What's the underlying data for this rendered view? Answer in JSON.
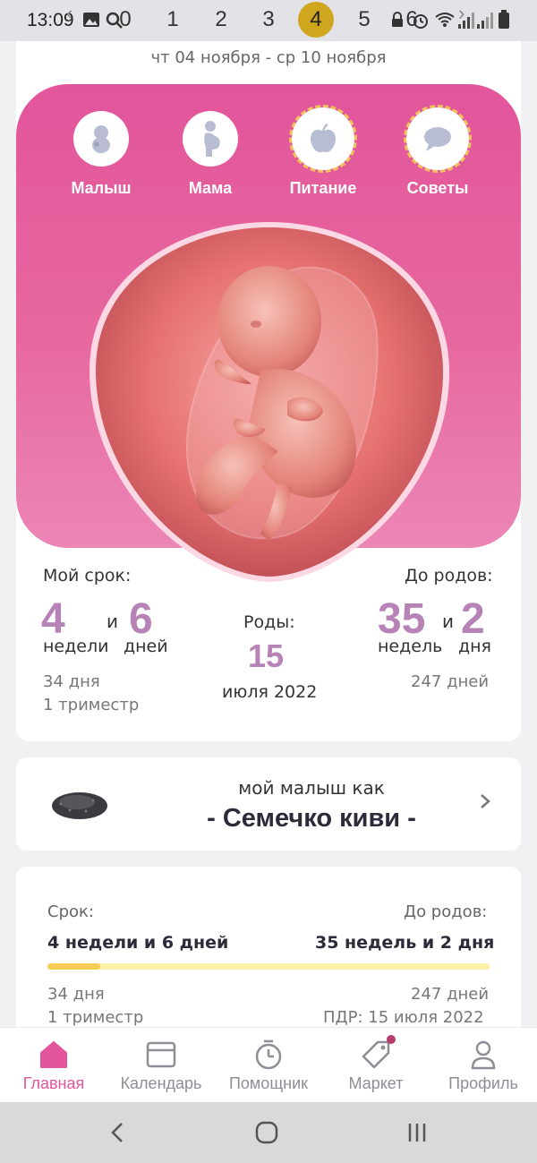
{
  "status_bar": {
    "time": "13:09",
    "week_numbers": [
      "0",
      "1",
      "2",
      "3",
      "4",
      "5",
      "6"
    ],
    "active_week": "4",
    "icons": [
      "gallery-icon",
      "search-icon",
      "lock-icon",
      "alarm-icon",
      "wifi-icon",
      "signal-icon",
      "battery-icon"
    ]
  },
  "header": {
    "date_range": "чт 04 ноября - ср 10 ноября"
  },
  "category_nav": [
    {
      "label": "Малыш",
      "icon": "baby-icon"
    },
    {
      "label": "Мама",
      "icon": "pregnant-woman-icon"
    },
    {
      "label": "Питание",
      "icon": "apple-icon"
    },
    {
      "label": "Советы",
      "icon": "chat-bubble-icon"
    }
  ],
  "stats": {
    "my_term_label": "Мой срок:",
    "weeks_value": "4",
    "weeks_unit": "недели",
    "and_text": "и",
    "days_value": "6",
    "days_unit": "дней",
    "total_days": "34 дня",
    "trimester": "1 триместр",
    "birth_label": "Роды:",
    "birth_day": "15",
    "birth_month_year": "июля 2022",
    "until_birth_label": "До родов:",
    "remaining_weeks": "35",
    "remaining_weeks_unit": "недель",
    "remaining_and": "и",
    "remaining_days": "2",
    "remaining_days_unit": "дня",
    "remaining_total_days": "247 дней"
  },
  "size_card": {
    "subtitle": "мой малыш как",
    "title": "- Семечко киви -",
    "image": "kiwi-seeds-image"
  },
  "progress_card": {
    "term_label": "Срок:",
    "term_value": "4 недели и 6 дней",
    "until_label": "До родов:",
    "until_value": "35 недель и 2 дня",
    "progress_fraction": 0.12,
    "days": "34 дня",
    "trimester": "1 триместр",
    "remaining_days": "247 дней",
    "due_date": "ПДР: 15 июля 2022"
  },
  "bottom_nav": [
    {
      "label": "Главная",
      "icon": "home-icon",
      "active": true
    },
    {
      "label": "Календарь",
      "icon": "calendar-icon",
      "active": false
    },
    {
      "label": "Помощник",
      "icon": "timer-icon",
      "active": false
    },
    {
      "label": "Маркет",
      "icon": "tag-icon",
      "active": false,
      "badge": true
    },
    {
      "label": "Профиль",
      "icon": "profile-icon",
      "active": false
    }
  ],
  "colors": {
    "accent_pink": "#e2559b",
    "number_purple": "#b782b5",
    "progress_fill": "#f6cc53",
    "progress_track": "#fbf0a6",
    "active_week_badge": "#cfa61d"
  }
}
